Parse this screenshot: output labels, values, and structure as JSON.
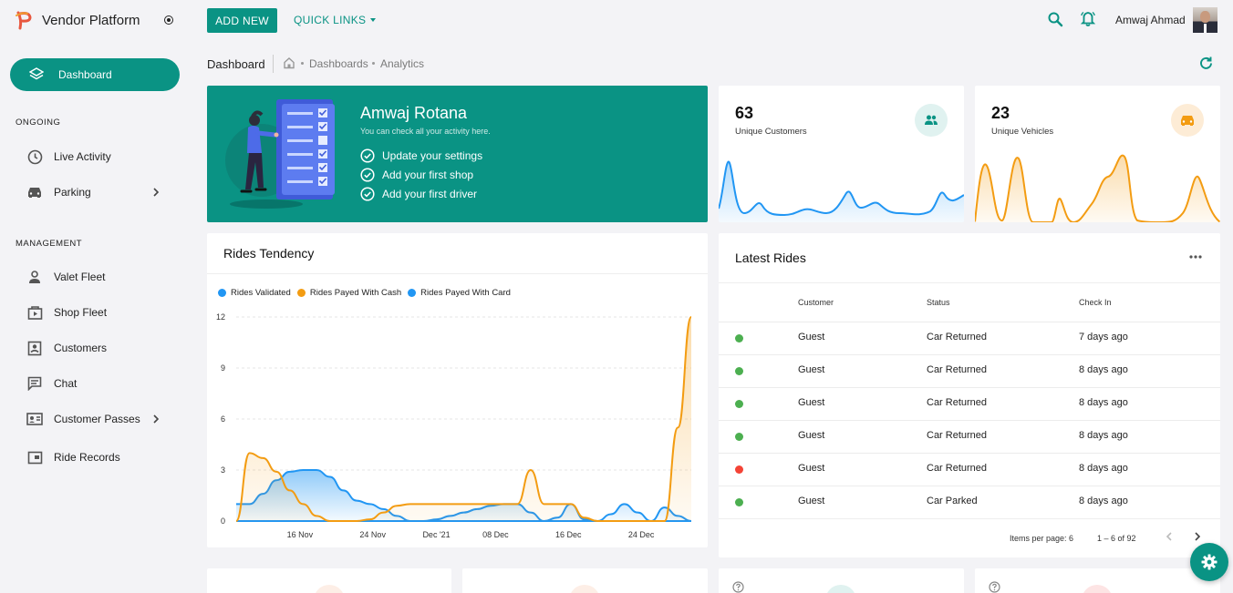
{
  "brand": {
    "name": "Vendor Platform",
    "logo_icon": "p-logo-icon"
  },
  "topbar": {
    "add_new": "ADD NEW",
    "quick_links": "QUICK LINKS",
    "user_name": "Amwaj Ahmad"
  },
  "sidebar": {
    "active": {
      "label": "Dashboard",
      "icon": "layers-icon"
    },
    "sections": [
      {
        "title": "ONGOING",
        "items": [
          {
            "label": "Live Activity",
            "icon": "clock-icon"
          },
          {
            "label": "Parking",
            "icon": "car-icon",
            "expandable": true
          }
        ]
      },
      {
        "title": "MANAGEMENT",
        "items": [
          {
            "label": "Valet Fleet",
            "icon": "person-icon"
          },
          {
            "label": "Shop Fleet",
            "icon": "shop-icon"
          },
          {
            "label": "Customers",
            "icon": "badge-icon"
          },
          {
            "label": "Chat",
            "icon": "chat-icon"
          },
          {
            "label": "Customer Passes",
            "icon": "id-card-icon",
            "expandable": true
          },
          {
            "label": "Ride Records",
            "icon": "record-icon"
          }
        ]
      }
    ]
  },
  "breadcrumb": {
    "title": "Dashboard",
    "items": [
      "Dashboards",
      "Analytics"
    ]
  },
  "welcome": {
    "name": "Amwaj Rotana",
    "subtitle": "You can check all your activity here.",
    "tasks": [
      "Update your settings",
      "Add your first shop",
      "Add your first driver"
    ]
  },
  "stats": [
    {
      "value": "63",
      "label": "Unique Customers",
      "color": "#2196f3",
      "badge_bg": "#e0f2f0",
      "icon": "people-icon"
    },
    {
      "value": "23",
      "label": "Unique Vehicles",
      "color": "#f39c12",
      "badge_bg": "#fdecd6",
      "icon": "car-icon"
    }
  ],
  "tendency": {
    "title": "Rides Tendency",
    "chart_data": {
      "type": "area",
      "x_ticks": [
        "16 Nov",
        "24 Nov",
        "Dec '21",
        "08 Dec",
        "16 Dec",
        "24 Dec"
      ],
      "ylim": [
        0,
        12
      ],
      "y_ticks": [
        "0",
        "3",
        "6",
        "9",
        "12"
      ],
      "series": [
        {
          "name": "Rides Validated",
          "color": "#2196f3",
          "values": [
            1,
            1,
            1.6,
            2.4,
            2.9,
            3,
            3,
            2.6,
            1.8,
            1.2,
            1,
            0.7,
            0.3,
            0,
            0,
            0.1,
            0.3,
            0.5,
            0.7,
            0.9,
            1,
            1,
            0.5,
            0,
            0.2,
            1,
            0.1,
            0,
            0.4,
            1,
            0.5,
            0,
            0.8,
            0.3,
            0
          ]
        },
        {
          "name": "Rides Payed With Cash",
          "color": "#f39c12",
          "values": [
            0,
            4,
            3.7,
            2.9,
            1.8,
            1,
            0.3,
            0,
            0,
            0,
            0.1,
            0.5,
            0.9,
            1,
            1,
            1,
            1,
            1,
            1,
            1,
            1,
            1,
            3,
            1,
            1,
            1,
            0.2,
            0,
            0,
            0,
            0,
            0,
            0,
            5.5,
            12
          ]
        },
        {
          "name": "Rides Payed With Card",
          "color": "#2196f3",
          "values": [
            0,
            0,
            0,
            0,
            0,
            0,
            0,
            0,
            0,
            0,
            0,
            0,
            0,
            0,
            0,
            0,
            0,
            0,
            0,
            0,
            0,
            0,
            0,
            0,
            0,
            0,
            0,
            0,
            0,
            0,
            0,
            0,
            0,
            0,
            0
          ]
        }
      ]
    }
  },
  "latest": {
    "title": "Latest Rides",
    "columns": [
      "Customer",
      "Status",
      "Check In"
    ],
    "rows": [
      {
        "status_color": "#4caf50",
        "customer": "Guest",
        "status": "Car Returned",
        "check_in": "7 days ago"
      },
      {
        "status_color": "#4caf50",
        "customer": "Guest",
        "status": "Car Returned",
        "check_in": "8 days ago"
      },
      {
        "status_color": "#4caf50",
        "customer": "Guest",
        "status": "Car Returned",
        "check_in": "8 days ago"
      },
      {
        "status_color": "#4caf50",
        "customer": "Guest",
        "status": "Car Returned",
        "check_in": "8 days ago"
      },
      {
        "status_color": "#f44336",
        "customer": "Guest",
        "status": "Car Returned",
        "check_in": "8 days ago"
      },
      {
        "status_color": "#4caf50",
        "customer": "Guest",
        "status": "Car Parked",
        "check_in": "8 days ago"
      }
    ],
    "pager": {
      "items_per_page": "Items per page: 6",
      "range": "1 – 6 of 92"
    }
  },
  "colors": {
    "accent": "#0a9384",
    "blue": "#2196f3",
    "orange": "#f39c12"
  }
}
